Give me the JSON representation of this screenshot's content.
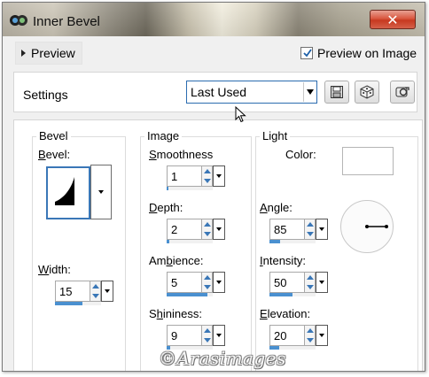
{
  "window": {
    "title": "Inner Bevel",
    "close_glyph": "✕"
  },
  "preview": {
    "toggle_label": "Preview",
    "preview_on_image_label": "Preview on Image",
    "preview_on_image_checked": true
  },
  "settings": {
    "label": "Settings",
    "preset_value": "Last Used",
    "buttons": [
      "save-preset-icon",
      "randomize-icon",
      "reset-icon"
    ]
  },
  "bevel": {
    "group_title": "Bevel",
    "bevel_label_prefix": "B",
    "bevel_label_rest": "evel:",
    "width_label_prefix": "W",
    "width_label_rest": "idth:",
    "width_value": "15",
    "width_fraction": 0.6
  },
  "image": {
    "group_title": "Image",
    "smoothness": {
      "label_prefix": "S",
      "label_rest": "moothness",
      "value": "1",
      "fraction": 0.03
    },
    "depth": {
      "label_prefix": "D",
      "label_rest": "epth:",
      "value": "2",
      "fraction": 0.05
    },
    "ambience": {
      "label_pre": "Am",
      "label_u": "b",
      "label_post": "ience:",
      "value": "5",
      "fraction": 0.88
    },
    "shininess": {
      "label_pre": "S",
      "label_u": "h",
      "label_post": "ininess:",
      "value": "9",
      "fraction": 0.08
    }
  },
  "light": {
    "group_title": "Light",
    "color_label": "Color:",
    "color_value": "#ffffff",
    "angle": {
      "label_prefix": "A",
      "label_rest": "ngle:",
      "value": "85",
      "fraction": 0.24
    },
    "intensity": {
      "label_prefix": "I",
      "label_rest": "ntensity:",
      "value": "50",
      "fraction": 0.5
    },
    "elevation": {
      "label_prefix": "E",
      "label_rest": "levation:",
      "value": "20",
      "fraction": 0.22
    }
  },
  "watermark": "©Arasimages",
  "colors": {
    "accent": "#4a90d0",
    "close": "#c7381f"
  }
}
